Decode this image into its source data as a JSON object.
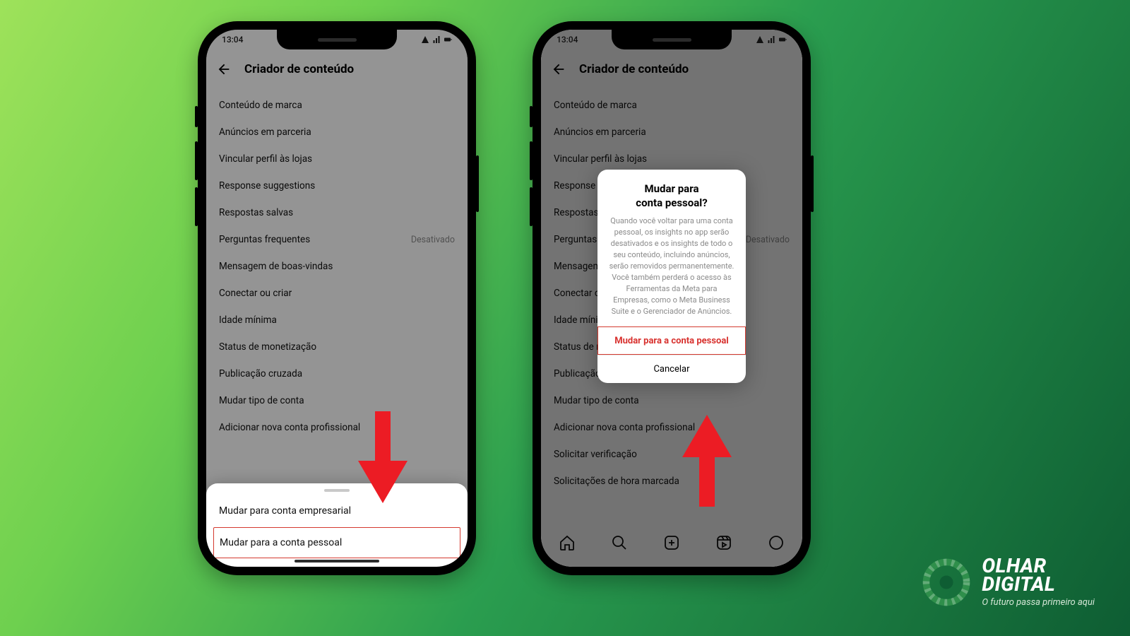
{
  "status": {
    "time": "13:04"
  },
  "screen": {
    "header_title": "Criador de conteúdo",
    "items": [
      {
        "label": "Conteúdo de marca",
        "tag": ""
      },
      {
        "label": "Anúncios em parceria",
        "tag": ""
      },
      {
        "label": "Vincular perfil às lojas",
        "tag": ""
      },
      {
        "label": "Response suggestions",
        "tag": ""
      },
      {
        "label": "Respostas salvas",
        "tag": ""
      },
      {
        "label": "Perguntas frequentes",
        "tag": "Desativado"
      },
      {
        "label": "Mensagem de boas-vindas",
        "tag": ""
      },
      {
        "label": "Conectar ou criar",
        "tag": ""
      },
      {
        "label": "Idade mínima",
        "tag": ""
      },
      {
        "label": "Status de monetização",
        "tag": ""
      },
      {
        "label": "Publicação cruzada",
        "tag": ""
      },
      {
        "label": "Mudar tipo de conta",
        "tag": ""
      },
      {
        "label": "Adicionar nova conta profissional",
        "tag": ""
      },
      {
        "label": "Solicitar verificação",
        "tag": ""
      },
      {
        "label": "Solicitações de hora marcada",
        "tag": ""
      }
    ]
  },
  "sheet": {
    "opt_business": "Mudar para conta empresarial",
    "opt_personal": "Mudar para a conta pessoal"
  },
  "dialog": {
    "title_l1": "Mudar para",
    "title_l2": "conta pessoal?",
    "body": "Quando você voltar para uma conta pessoal, os insights no app serão desativados e os insights de todo o seu conteúdo, incluindo anúncios, serão removidos permanentemente. Você também perderá o acesso às Ferramentas da Meta para Empresas, como o Meta Business Suite e o Gerenciador de Anúncios.",
    "primary": "Mudar para a conta pessoal",
    "cancel": "Cancelar"
  },
  "brand": {
    "line1": "OLHAR",
    "line2": "DIGITAL",
    "tagline": "O futuro passa primeiro aqui"
  }
}
